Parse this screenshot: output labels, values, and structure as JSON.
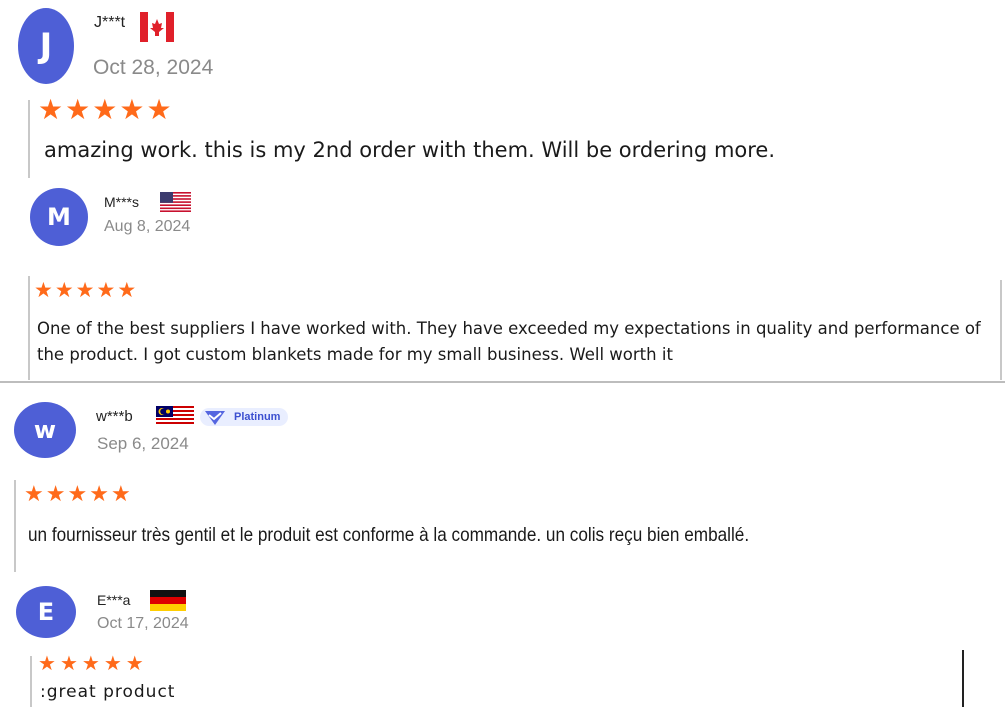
{
  "reviews": [
    {
      "initial": "J",
      "name": "J***t",
      "country_flag": "canada-flag-icon",
      "date": "Oct 28, 2024",
      "rating": 5,
      "text": "amazing work. this is my 2nd order with them. Will be ordering more."
    },
    {
      "initial": "M",
      "name": "M***s",
      "country_flag": "usa-flag-icon",
      "date": "Aug 8, 2024",
      "rating": 5,
      "text": "One of the best suppliers I have worked with. They have exceeded my expectations in quality and performance of the product. I got custom blankets made for my small business. Well worth it"
    },
    {
      "initial": "w",
      "name": "w***b",
      "country_flag": "malaysia-flag-icon",
      "badge": "Platinum",
      "date": "Sep 6, 2024",
      "rating": 5,
      "text": "un fournisseur très gentil et le produit est conforme à la commande. un colis reçu bien emballé."
    },
    {
      "initial": "E",
      "name": "E***a",
      "country_flag": "germany-flag-icon",
      "date": "Oct 17, 2024",
      "rating": 5,
      "text": ":great product"
    }
  ],
  "colors": {
    "avatar": "#4e5fd6",
    "star": "#ff6a1a",
    "badge_text": "#3b4fd0"
  }
}
